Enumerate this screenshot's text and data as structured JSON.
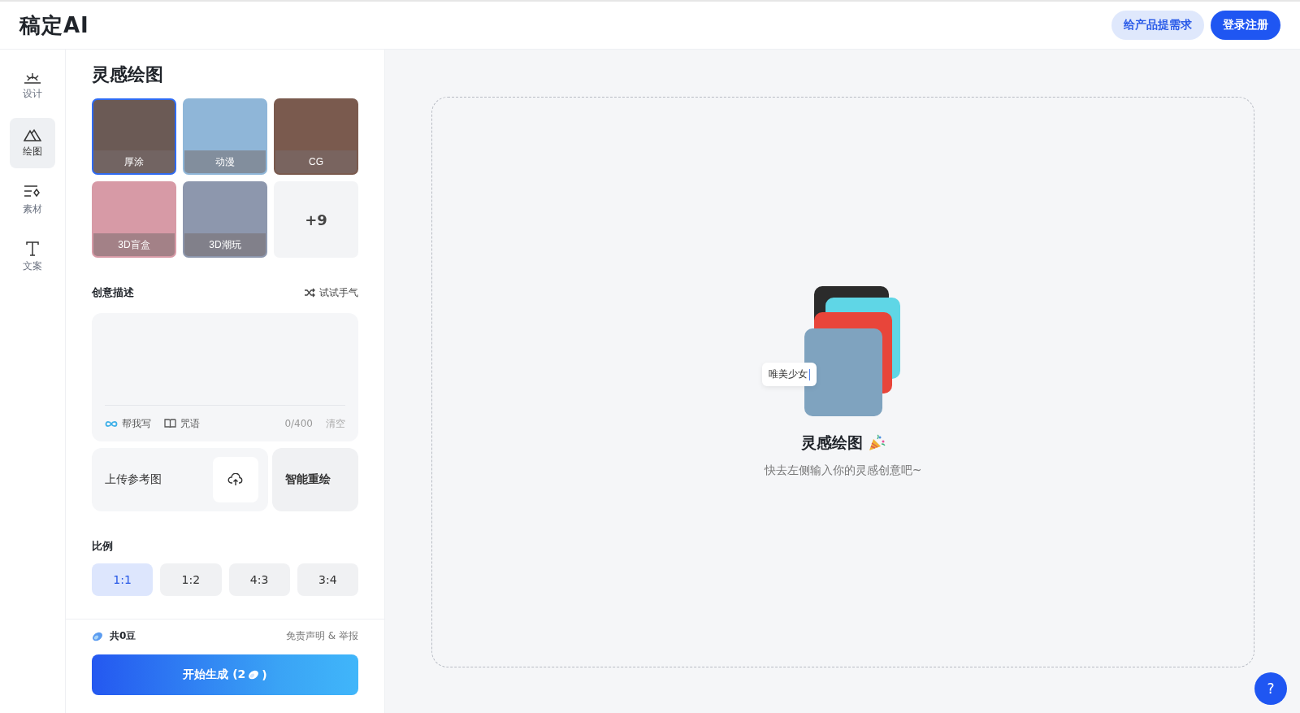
{
  "header": {
    "logo": "稿定AI",
    "buttons": [
      {
        "label": "给产品提需求",
        "kind": "secondary"
      },
      {
        "label": "登录注册",
        "kind": "primary"
      }
    ]
  },
  "nav": [
    {
      "label": "设计",
      "kind": "design",
      "selected": false
    },
    {
      "label": "绘图",
      "kind": "draw",
      "selected": true
    },
    {
      "label": "素材",
      "kind": "assets",
      "selected": false
    },
    {
      "label": "文案",
      "kind": "text",
      "selected": false
    }
  ],
  "panel": {
    "title": "灵感绘图",
    "styles": [
      {
        "label": "厚涂",
        "selected": true
      },
      {
        "label": "动漫",
        "selected": false
      },
      {
        "label": "CG",
        "selected": false
      },
      {
        "label": "3D盲盒",
        "selected": false
      },
      {
        "label": "3D潮玩",
        "selected": false
      }
    ],
    "more": "+9",
    "prompt": {
      "heading": "创意描述",
      "shuffle": "试试手气",
      "tools": [
        {
          "label": "帮我写",
          "kind": "write"
        },
        {
          "label": "咒语",
          "kind": "book"
        }
      ],
      "count": "0/400",
      "clear": "清空"
    },
    "upload": "上传参考图",
    "redraw": "智能重绘",
    "ratio": {
      "heading": "比例",
      "options": [
        {
          "label": "1:1",
          "selected": true
        },
        {
          "label": "1:2",
          "selected": false
        },
        {
          "label": "4:3",
          "selected": false
        },
        {
          "label": "3:4",
          "selected": false
        }
      ]
    },
    "footer": {
      "beans": "共0豆",
      "disclaimer": "免责声明 & 举报",
      "generate": "开始生成 (2",
      "generate_end": ")"
    }
  },
  "canvas": {
    "tag": "唯美少女",
    "title": "灵感绘图",
    "subtitle": "快去左侧输入你的灵感创意吧~"
  },
  "help": "?"
}
